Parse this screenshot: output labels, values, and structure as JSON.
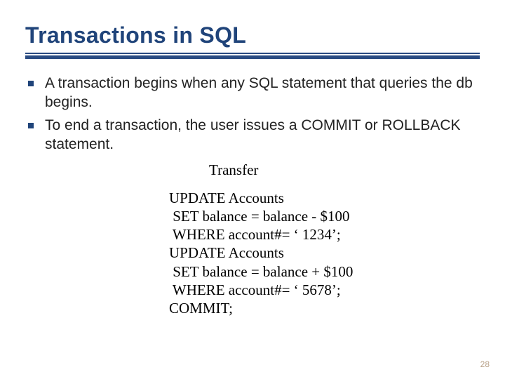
{
  "title": "Transactions in SQL",
  "bullets": [
    "A transaction begins when any SQL statement that queries the db begins.",
    "To end a transaction, the user issues a COMMIT or ROLLBACK statement."
  ],
  "code": {
    "caption": "Transfer",
    "lines": "UPDATE Accounts\n SET balance = balance - $100\n WHERE account#= ‘ 1234’;\nUPDATE Accounts\n SET balance = balance + $100\n WHERE account#= ‘ 5678’;\nCOMMIT;"
  },
  "page_number": "28"
}
